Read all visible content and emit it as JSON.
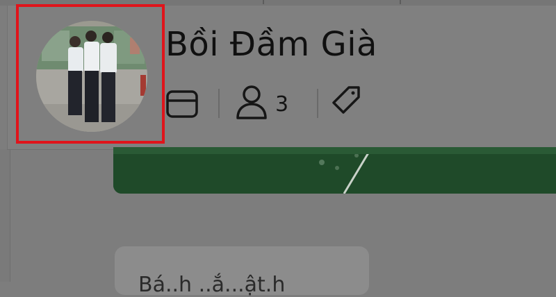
{
  "group": {
    "name": "Bồi Đầm Già",
    "member_count": "3"
  },
  "post": {
    "preview_text": "Bá..h ..ắ...ật.h"
  },
  "icons": {
    "group_type": "web-browser-icon",
    "members": "person-icon",
    "tags": "tag-icon"
  },
  "colors": {
    "highlight_frame": "#e0141b",
    "banner": "#1f4a29",
    "overlay": "#7d7d7d"
  }
}
